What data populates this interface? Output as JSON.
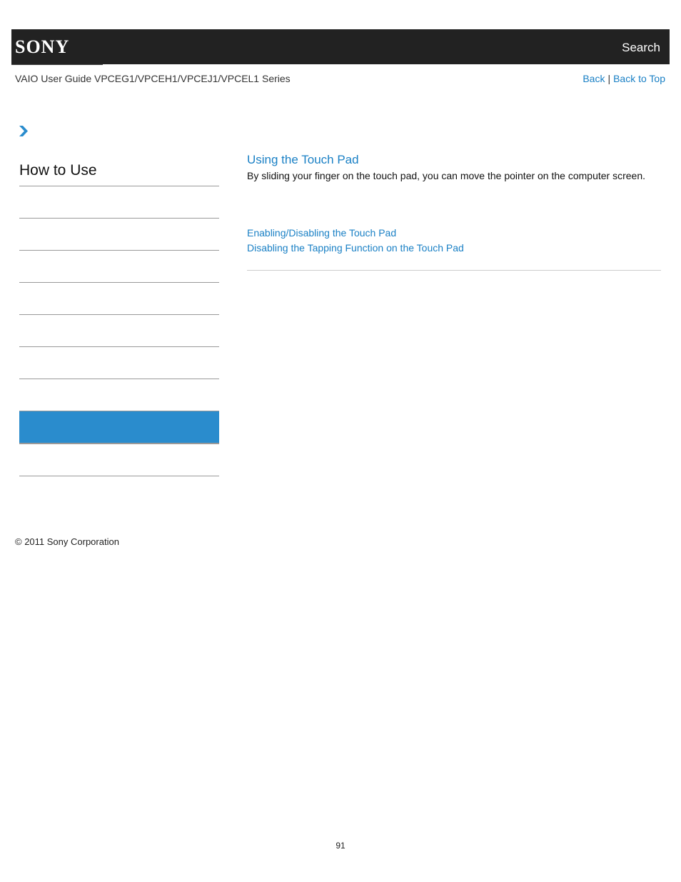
{
  "header": {
    "logo": "SONY",
    "search_label": "Search"
  },
  "subheader": {
    "guide_title": "VAIO User Guide VPCEG1/VPCEH1/VPCEJ1/VPCEL1 Series",
    "back_label": "Back",
    "separator": "|",
    "back_to_top_label": "Back to Top"
  },
  "breadcrumb": {
    "icon": "chevron-right-icon"
  },
  "sidebar": {
    "title": "How to Use",
    "items": [
      {
        "label": "",
        "active": false
      },
      {
        "label": "",
        "active": false
      },
      {
        "label": "",
        "active": false
      },
      {
        "label": "",
        "active": false
      },
      {
        "label": "",
        "active": false
      },
      {
        "label": "",
        "active": false
      },
      {
        "label": "",
        "active": false
      },
      {
        "label": "",
        "active": true
      },
      {
        "label": "",
        "active": false
      }
    ],
    "active_color": "#2a8ccd"
  },
  "content": {
    "title": "Using the Touch Pad",
    "description": "By sliding your finger on the touch pad, you can move the pointer on the computer screen.",
    "related_links": [
      "Enabling/Disabling the Touch Pad",
      "Disabling the Tapping Function on the Touch Pad"
    ],
    "link_color": "#1a80c5"
  },
  "footer": {
    "copyright": "© 2011 Sony Corporation",
    "page_number": "91"
  }
}
